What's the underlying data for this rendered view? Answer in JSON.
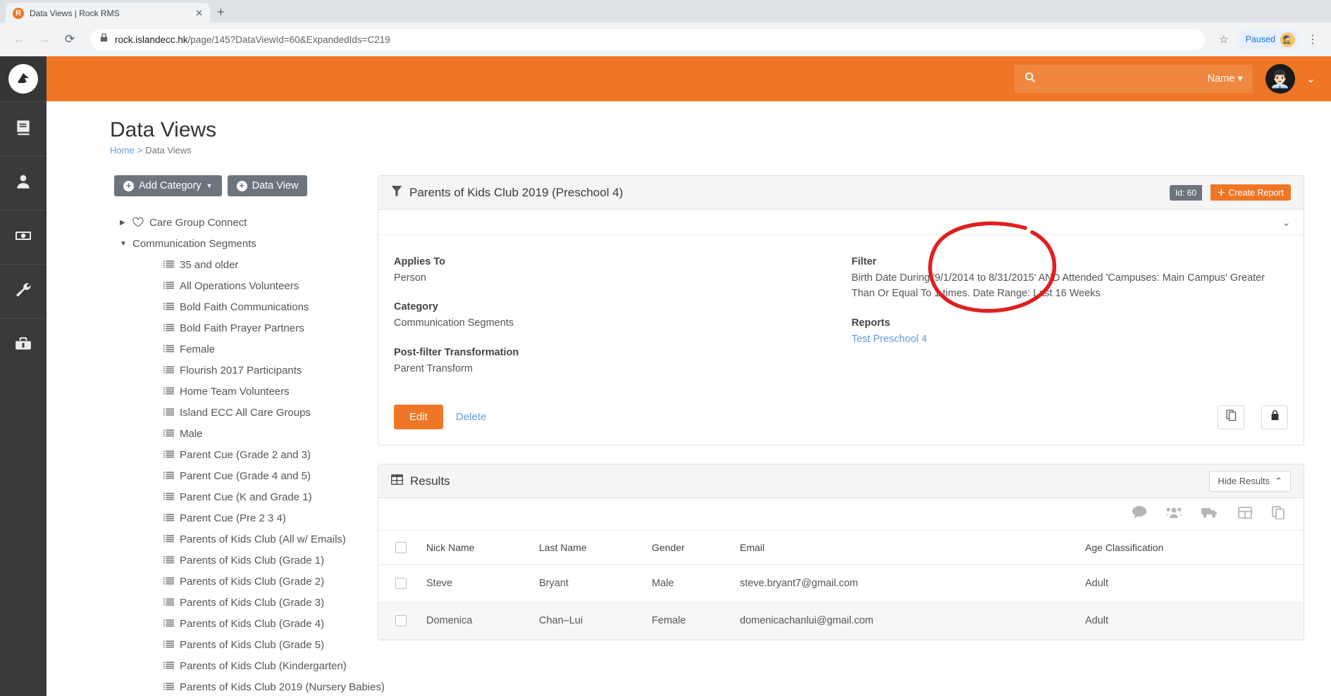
{
  "browser": {
    "tab_title": "Data Views | Rock RMS",
    "tab_close_icon": "close-icon",
    "new_tab_icon": "plus-icon",
    "back_icon": "arrow-left-icon",
    "forward_icon": "arrow-right-icon",
    "reload_icon": "reload-icon",
    "lock_icon": "lock-icon",
    "url_host": "rock.islandecc.hk",
    "url_path": "/page/145?DataViewId=60&ExpandedIds=C219",
    "star_icon": "star-icon",
    "paused_label": "Paused",
    "profile_icon": "profile-avatar-icon",
    "menu_icon": "kebab-menu-icon"
  },
  "rail": {
    "logo_icon": "rock-logo-icon",
    "items": [
      {
        "icon": "book-icon",
        "name": "cms"
      },
      {
        "icon": "person-icon",
        "name": "people"
      },
      {
        "icon": "money-icon",
        "name": "finance"
      },
      {
        "icon": "wrench-icon",
        "name": "admin-tools"
      },
      {
        "icon": "toolbox-icon",
        "name": "tools"
      }
    ]
  },
  "topbar": {
    "search_icon": "search-icon",
    "search_value": "",
    "search_placeholder": "",
    "name_filter_label": "Name",
    "name_filter_caret": "caret-down-icon",
    "avatar_icon": "user-avatar",
    "user_caret_icon": "chevron-down-icon"
  },
  "page": {
    "title": "Data Views",
    "breadcrumb": {
      "home": "Home",
      "separator": ">",
      "current": "Data Views"
    }
  },
  "tree_toolbar": {
    "add_category_label": "Add Category",
    "add_category_icon": "plus-circle-icon",
    "add_category_caret": "caret-down-icon",
    "data_view_label": "Data View",
    "data_view_icon": "plus-circle-icon"
  },
  "tree": {
    "items": [
      {
        "label": "Care Group Connect",
        "level": 0,
        "twisty": "collapsed",
        "icon": "heart-icon"
      },
      {
        "label": "Communication Segments",
        "level": 0,
        "twisty": "expanded",
        "icon": ""
      },
      {
        "label": "35 and older",
        "level": 1,
        "twisty": "",
        "icon": "list-icon"
      },
      {
        "label": "All Operations Volunteers",
        "level": 1,
        "twisty": "",
        "icon": "list-icon"
      },
      {
        "label": "Bold Faith Communications",
        "level": 1,
        "twisty": "",
        "icon": "list-icon"
      },
      {
        "label": "Bold Faith Prayer Partners",
        "level": 1,
        "twisty": "",
        "icon": "list-icon"
      },
      {
        "label": "Female",
        "level": 1,
        "twisty": "",
        "icon": "list-icon"
      },
      {
        "label": "Flourish 2017 Participants",
        "level": 1,
        "twisty": "",
        "icon": "list-icon"
      },
      {
        "label": "Home Team Volunteers",
        "level": 1,
        "twisty": "",
        "icon": "list-icon"
      },
      {
        "label": "Island ECC All Care Groups",
        "level": 1,
        "twisty": "",
        "icon": "list-icon"
      },
      {
        "label": "Male",
        "level": 1,
        "twisty": "",
        "icon": "list-icon"
      },
      {
        "label": "Parent Cue (Grade 2 and 3)",
        "level": 1,
        "twisty": "",
        "icon": "list-icon"
      },
      {
        "label": "Parent Cue (Grade 4 and 5)",
        "level": 1,
        "twisty": "",
        "icon": "list-icon"
      },
      {
        "label": "Parent Cue (K and Grade 1)",
        "level": 1,
        "twisty": "",
        "icon": "list-icon"
      },
      {
        "label": "Parent Cue (Pre 2 3 4)",
        "level": 1,
        "twisty": "",
        "icon": "list-icon"
      },
      {
        "label": "Parents of Kids Club (All w/ Emails)",
        "level": 1,
        "twisty": "",
        "icon": "list-icon"
      },
      {
        "label": "Parents of Kids Club (Grade 1)",
        "level": 1,
        "twisty": "",
        "icon": "list-icon"
      },
      {
        "label": "Parents of Kids Club (Grade 2)",
        "level": 1,
        "twisty": "",
        "icon": "list-icon"
      },
      {
        "label": "Parents of Kids Club (Grade 3)",
        "level": 1,
        "twisty": "",
        "icon": "list-icon"
      },
      {
        "label": "Parents of Kids Club (Grade 4)",
        "level": 1,
        "twisty": "",
        "icon": "list-icon"
      },
      {
        "label": "Parents of Kids Club (Grade 5)",
        "level": 1,
        "twisty": "",
        "icon": "list-icon"
      },
      {
        "label": "Parents of Kids Club (Kindergarten)",
        "level": 1,
        "twisty": "",
        "icon": "list-icon"
      },
      {
        "label": "Parents of Kids Club 2019 (Nursery Babies)",
        "level": 1,
        "twisty": "",
        "icon": "list-icon"
      }
    ]
  },
  "dataview_panel": {
    "icon": "filter-icon",
    "title": "Parents of Kids Club 2019 (Preschool 4)",
    "id_badge": "Id: 60",
    "create_report_label": "Create Report",
    "create_report_icon": "plus-icon",
    "collapse_icon": "chevron-down-icon",
    "fields": {
      "applies_to_label": "Applies To",
      "applies_to_value": "Person",
      "category_label": "Category",
      "category_value": "Communication Segments",
      "post_filter_label": "Post-filter Transformation",
      "post_filter_value": "Parent Transform",
      "filter_label": "Filter",
      "filter_value": "Birth Date During '9/1/2014 to 8/31/2015' AND Attended 'Campuses: Main Campus' Greater Than Or Equal To 1 times. Date Range: Last 16 Weeks",
      "reports_label": "Reports",
      "reports_link": "Test Preschool 4"
    },
    "edit_label": "Edit",
    "delete_label": "Delete",
    "copy_icon": "copy-icon",
    "security_icon": "lock-icon"
  },
  "annotation": {
    "shape": "hand-drawn-circle",
    "color": "#e02020",
    "target_text": "9/1/2014 to 8/31/2015"
  },
  "results_panel": {
    "icon": "table-icon",
    "title": "Results",
    "hide_label": "Hide Results",
    "hide_caret": "chevron-up-icon",
    "toolbar_icons": [
      "comment-icon",
      "people-icon",
      "truck-icon",
      "grid-icon",
      "copy-icon"
    ],
    "columns": [
      "Nick Name",
      "Last Name",
      "Gender",
      "Email",
      "Age Classification"
    ],
    "rows": [
      {
        "nick_name": "Steve",
        "last_name": "Bryant",
        "gender": "Male",
        "email": "steve.bryant7@gmail.com",
        "age_classification": "Adult"
      },
      {
        "nick_name": "Domenica",
        "last_name": "Chan–Lui",
        "gender": "Female",
        "email": "domenicachanlui@gmail.com",
        "age_classification": "Adult"
      }
    ]
  },
  "colors": {
    "brand_orange": "#ee7624",
    "rail_dark": "#3a3a3a",
    "link_blue": "#5e9ed6",
    "annotation_red": "#e02020"
  }
}
